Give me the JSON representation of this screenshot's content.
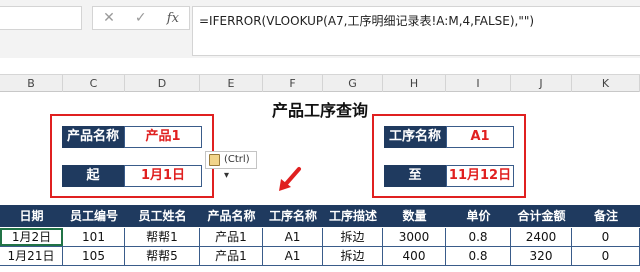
{
  "formula_bar": {
    "cancel_icon": "✕",
    "enter_icon": "✓",
    "fx_label": "fx",
    "formula": "=IFERROR(VLOOKUP(A7,工序明细记录表!A:M,4,FALSE),\"\")"
  },
  "columns": [
    "B",
    "C",
    "D",
    "E",
    "F",
    "G",
    "H",
    "I",
    "J",
    "K"
  ],
  "sheet": {
    "title": "产品工序查询",
    "product_label": "产品名称",
    "product_value": "产品1",
    "start_label": "起",
    "start_value": "1月1日",
    "process_label": "工序名称",
    "process_value": "A1",
    "end_label": "至",
    "end_value": "11月12日",
    "paste_options": "(Ctrl)"
  },
  "table": {
    "headers": [
      "日期",
      "员工编号",
      "员工姓名",
      "产品名称",
      "工序名称",
      "工序描述",
      "数量",
      "单价",
      "合计金额",
      "备注"
    ],
    "rows": [
      [
        "1月2日",
        "101",
        "帮帮1",
        "产品1",
        "A1",
        "拆边",
        "3000",
        "0.8",
        "2400",
        "0"
      ],
      [
        "1月21日",
        "105",
        "帮帮5",
        "产品1",
        "A1",
        "拆边",
        "400",
        "0.8",
        "320",
        "0"
      ]
    ]
  },
  "colors": {
    "header_fill": "#1f3a5f",
    "highlight_red": "#e02020",
    "selection_green": "#217346"
  }
}
